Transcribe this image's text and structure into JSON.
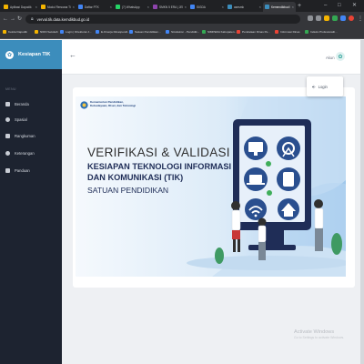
{
  "browser": {
    "tabs": [
      {
        "label": "Aplikasi Dapodik",
        "favicon_color": "#f4b400"
      },
      {
        "label": "Modul Rencana Ti",
        "favicon_color": "#f4b400"
      },
      {
        "label": "Daftar PTK",
        "favicon_color": "#4285f4"
      },
      {
        "label": "(7) WhatsApp",
        "favicon_color": "#25d366"
      },
      {
        "label": "SMKN 5 ERA | JEDIC",
        "favicon_color": "#8e44ad"
      },
      {
        "label": "SIGDA",
        "favicon_color": "#4285f4"
      },
      {
        "label": "asesmk",
        "favicon_color": "#3c8dbc"
      },
      {
        "label": "Kemendikbud Ser",
        "favicon_color": "#3c8dbc"
      }
    ],
    "active_tab_index": 7,
    "url": "verval.tik.data.kemdikbud.go.id",
    "bookmarks": [
      {
        "label": "Kelola Dapodik",
        "color": "#f4b400"
      },
      {
        "label": "NIDN Sekolah",
        "color": "#f4b400"
      },
      {
        "label": "Login | Direktorat J...",
        "color": "#4285f4"
      },
      {
        "label": "E-Kinerja Dinaspendi...",
        "color": "#4285f4"
      },
      {
        "label": "Satuan Pendidikan...",
        "color": "#4285f4"
      },
      {
        "label": "Simdatron - Pendidik...",
        "color": "#4285f4"
      },
      {
        "label": "SIMPEDA Kabupaten...",
        "color": "#34a853"
      },
      {
        "label": "Pendataan Dinas Pe...",
        "color": "#ea4335"
      },
      {
        "label": "Informasi Dinas",
        "color": "#ea4335"
      },
      {
        "label": "Indeks Profesionalit...",
        "color": "#34a853"
      }
    ]
  },
  "sidebar": {
    "app_title": "Kesiapan TIK",
    "section_label": "MENU",
    "items": [
      {
        "label": "Beranda",
        "icon": "home-icon"
      },
      {
        "label": "Spasial",
        "icon": "map-pin-icon"
      },
      {
        "label": "Rangkuman",
        "icon": "list-icon"
      },
      {
        "label": "Keterangan",
        "icon": "info-icon"
      },
      {
        "label": "Panduan",
        "icon": "book-icon"
      }
    ]
  },
  "header": {
    "user_name": "Akun"
  },
  "dropdown": {
    "item_label": "Login",
    "item_icon": "login-icon"
  },
  "banner": {
    "org_line1": "Kementerian Pendidikan,",
    "org_line2": "Kebudayaan, Riset, dan Teknologi",
    "title_line1": "VERIFIKASI & VALIDASI",
    "title_line2": "KESIAPAN TEKNOLOGI INFORMASI",
    "title_line3": "DAN KOMUNIKASI (TIK)",
    "title_line4": "SATUAN PENDIDIKAN"
  },
  "watermark": {
    "line1": "Activate Windows",
    "line2": "Go to Settings to activate Windows."
  },
  "colors": {
    "sidebar_bg": "#1d2330",
    "accent": "#3c8dbc",
    "banner_navy": "#1f2d57"
  }
}
